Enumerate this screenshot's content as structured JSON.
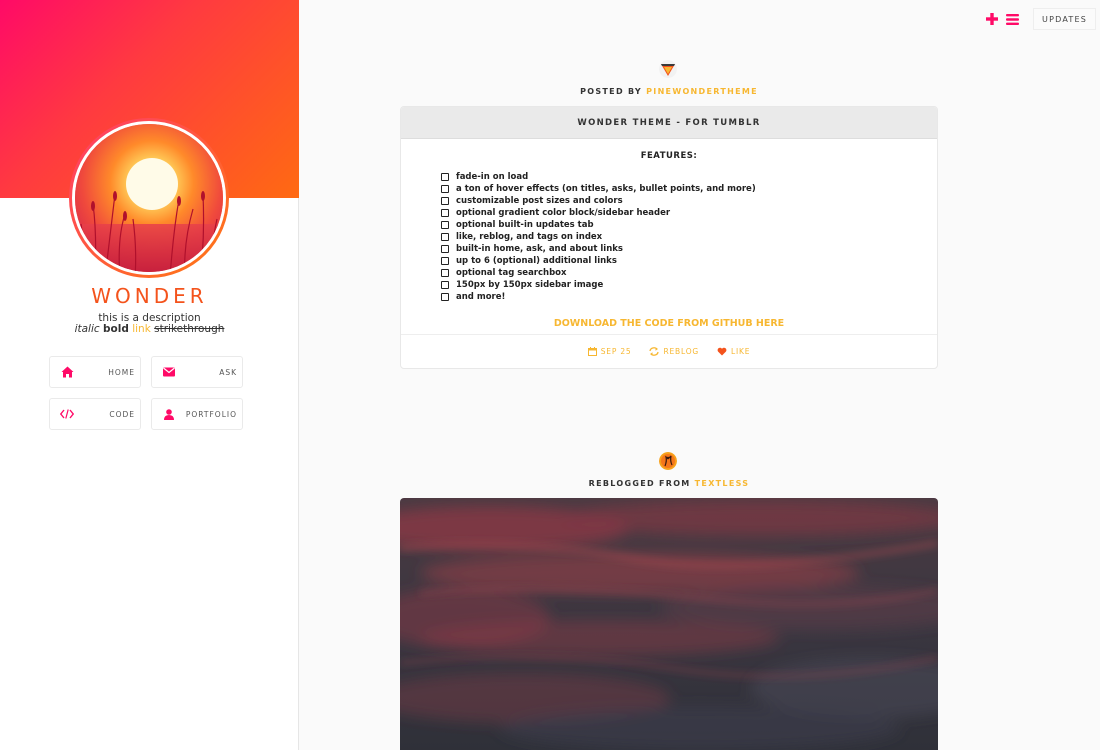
{
  "sidebar": {
    "title": "WONDER",
    "description": {
      "line1": "this is a description",
      "italic": "italic",
      "bold": "bold",
      "link": "link",
      "strike": "strikethrough"
    },
    "nav": [
      {
        "label": "HOME",
        "icon": "home-icon"
      },
      {
        "label": "ASK",
        "icon": "envelope-icon"
      },
      {
        "label": "CODE",
        "icon": "code-icon"
      },
      {
        "label": "PORTFOLIO",
        "icon": "user-icon"
      }
    ]
  },
  "top_actions": {
    "updates_label": "UPDATES",
    "icons": [
      "plus-icon",
      "menu-icon"
    ]
  },
  "colors": {
    "accent": "#f7b731",
    "pink": "#ff0a67",
    "orange": "#f4531c",
    "gradient_start": "#ff0a67",
    "gradient_end": "#ff6a12"
  },
  "posts": [
    {
      "meta_prefix": "POSTED BY",
      "author": "PINEWONDERTHEME",
      "title": "WONDER THEME - FOR TUMBLR",
      "features_heading": "FEATURES:",
      "features": [
        "fade-in on load",
        "a ton of hover effects (on titles, asks, bullet points, and more)",
        "customizable post sizes and colors",
        "optional gradient color block/sidebar header",
        "optional built-in updates tab",
        "like, reblog, and tags on index",
        "built-in home, ask, and about links",
        "up to 6 (optional) additional links",
        "optional tag searchbox",
        "150px by 150px sidebar image",
        "and more!"
      ],
      "download_link": "DOWNLOAD THE CODE FROM GITHUB HERE",
      "footer": {
        "date": "SEP 25",
        "reblog": "REBLOG",
        "like": "LIKE"
      }
    },
    {
      "meta_prefix": "REBLOGGED FROM",
      "author": "TEXTLESS"
    }
  ]
}
